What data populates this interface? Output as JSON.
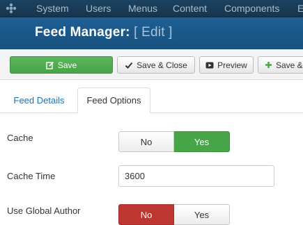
{
  "topnav": {
    "items": [
      "System",
      "Users",
      "Menus",
      "Content",
      "Components",
      "E"
    ]
  },
  "header": {
    "title": "Feed Manager:",
    "subtitle": "[ Edit ]"
  },
  "toolbar": {
    "save": {
      "label": "Save",
      "icon": "edit-icon"
    },
    "save_close": {
      "label": "Save & Close",
      "icon": "check-icon"
    },
    "preview": {
      "label": "Preview",
      "icon": "play-icon"
    },
    "save_new": {
      "label": "Save &",
      "icon": "plus-icon"
    }
  },
  "tabs": [
    {
      "label": "Feed Details",
      "active": false
    },
    {
      "label": "Feed Options",
      "active": true
    }
  ],
  "fields": {
    "cache": {
      "label": "Cache",
      "options": [
        "No",
        "Yes"
      ],
      "selected": "Yes"
    },
    "cache_time": {
      "label": "Cache Time",
      "value": "3600"
    },
    "use_global_author": {
      "label": "Use Global Author",
      "options": [
        "No",
        "Yes"
      ],
      "selected": "No"
    }
  },
  "colors": {
    "topnav_bg": "#163650",
    "header_bg": "#1e5f94",
    "save_green": "#46a546",
    "yes_green": "#46a546",
    "no_red": "#bd362f",
    "tab_link": "#1d6fb2"
  }
}
